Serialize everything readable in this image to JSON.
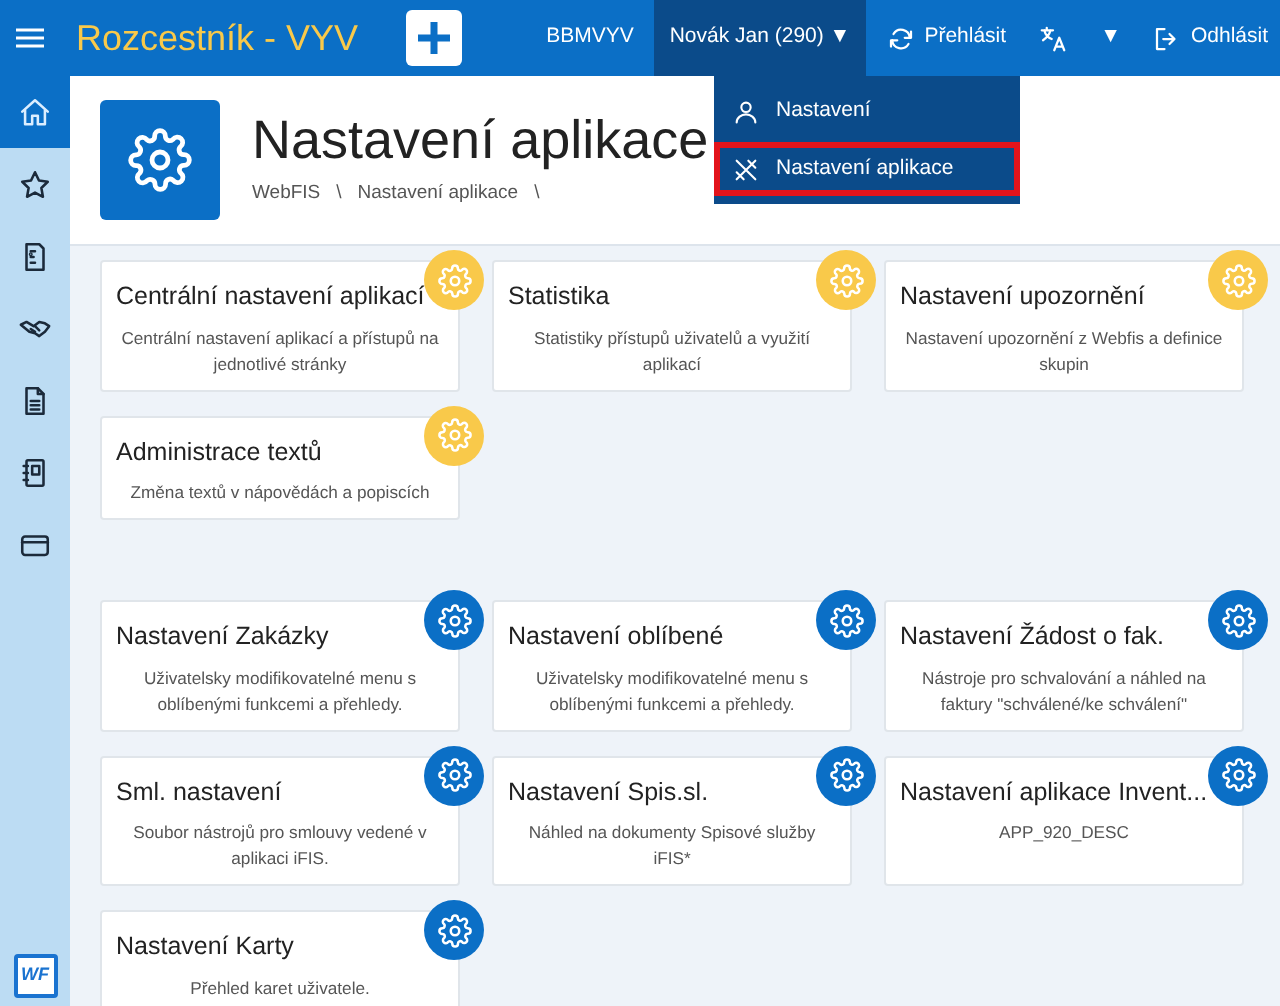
{
  "app_title": "Rozcestník - VYV",
  "topbar": {
    "company": "BBMVYV",
    "user": {
      "label": "Novák Jan (290)",
      "caret": "▼",
      "expanded": true
    },
    "relog": "Přehlásit",
    "language_caret": "▼",
    "logout": "Odhlásit"
  },
  "user_menu": [
    {
      "label": "Nastavení",
      "selected": false
    },
    {
      "label": "Nastavení aplikace",
      "selected": true
    }
  ],
  "sidebar": [
    {
      "selected": true
    },
    {
      "selected": false
    },
    {
      "selected": false
    },
    {
      "selected": false
    },
    {
      "selected": false
    },
    {
      "selected": false
    },
    {
      "selected": false
    }
  ],
  "logo_text": "WF",
  "page": {
    "title": "Nastavení aplikace",
    "breadcrumb": [
      "WebFIS",
      "Nastavení aplikace"
    ],
    "separator": "\\"
  },
  "groups": [
    {
      "kind": "central",
      "cards": [
        {
          "title": "Centrální nastavení aplikací",
          "description": "Centrální nastavení aplikací a přístupů na jednotlivé stránky"
        },
        {
          "title": "Statistika",
          "description": "Statistiky přístupů uživatelů a využití aplikací"
        },
        {
          "title": "Nastavení upozornění",
          "description": "Nastavení upozornění z Webfis a definice skupin"
        },
        {
          "title": "Administrace textů",
          "description": "Změna textů v nápovědách a popiscích"
        }
      ]
    },
    {
      "kind": "module",
      "cards": [
        {
          "title": "Nastavení Zakázky",
          "description": "Uživatelsky modifikovatelné menu s oblíbenými funkcemi a přehledy."
        },
        {
          "title": "Nastavení oblíbené",
          "description": "Uživatelsky modifikovatelné menu s oblíbenými funkcemi a přehledy."
        },
        {
          "title": "Nastavení Žádost o fak.",
          "description": "Nástroje pro schvalování a náhled na faktury \"schválené/ke schválení\""
        },
        {
          "title": "Sml. nastavení",
          "description": "Soubor nástrojů pro smlouvy vedené v aplikaci iFIS."
        },
        {
          "title": "Nastavení Spis.sl.",
          "description": "Náhled na dokumenty Spisové služby iFIS*"
        },
        {
          "title": "Nastavení aplikace Invent...",
          "description": "APP_920_DESC"
        },
        {
          "title": "Nastavení Karty",
          "description": "Přehled karet uživatele."
        }
      ]
    }
  ]
}
